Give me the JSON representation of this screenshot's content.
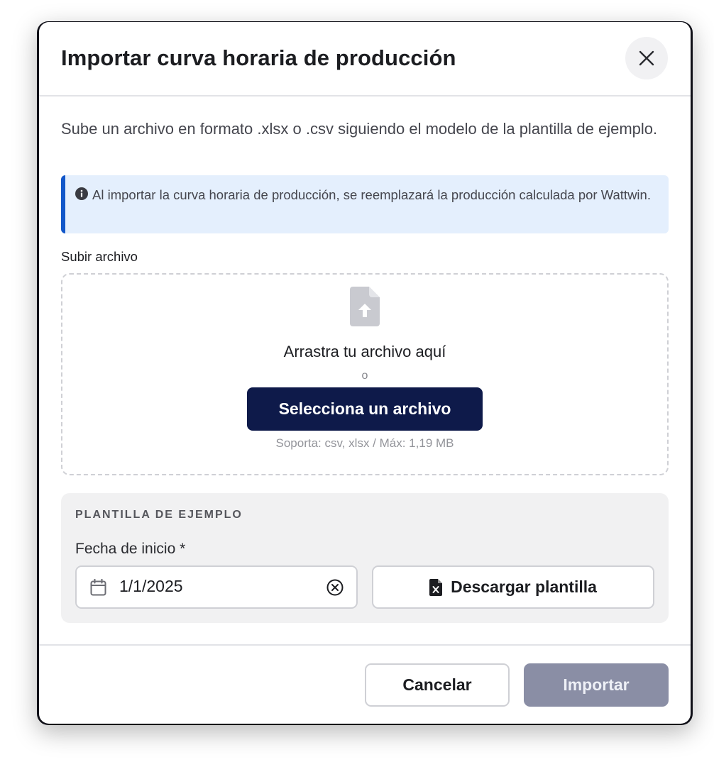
{
  "dialog": {
    "title": "Importar curva horaria de producción",
    "description": "Sube un archivo en formato .xlsx o .csv siguiendo el modelo de la plantilla de ejemplo.",
    "info": "Al importar la curva horaria de producción, se reemplazará la producción calculada por Wattwin."
  },
  "upload": {
    "label": "Subir archivo",
    "drag_text": "Arrastra tu archivo aquí",
    "or_text": "o",
    "select_button": "Selecciona un archivo",
    "support_text": "Soporta: csv, xlsx / Máx: 1,19 MB"
  },
  "template": {
    "section_title": "PLANTILLA DE EJEMPLO",
    "date_label": "Fecha de inicio *",
    "date_value": "1/1/2025",
    "download_button": "Descargar plantilla"
  },
  "footer": {
    "cancel_button": "Cancelar",
    "import_button": "Importar"
  },
  "icons": {
    "close": "close-icon",
    "info": "info-icon",
    "file_upload": "file-upload-icon",
    "calendar": "calendar-icon",
    "clear": "clear-icon",
    "excel_file": "excel-file-icon"
  },
  "colors": {
    "primary_button": "#0e1a4a",
    "info_accent": "#1257c9",
    "info_background": "#e4effd",
    "disabled_button": "#8a8ea5"
  }
}
